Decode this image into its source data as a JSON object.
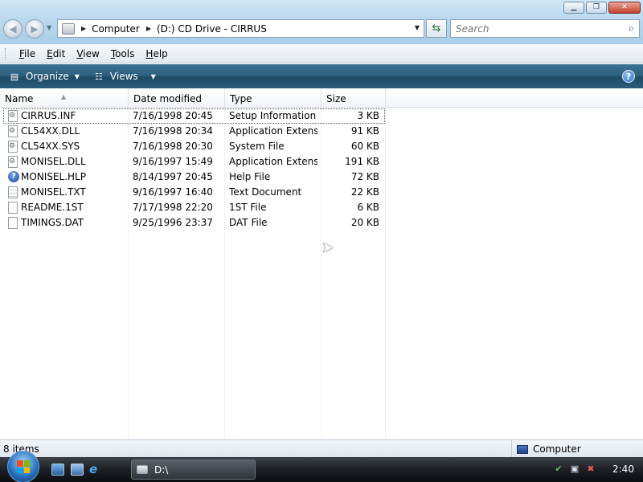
{
  "window": {
    "minimize_glyph": "▁",
    "maximize_glyph": "❐",
    "close_glyph": "✕"
  },
  "address": {
    "crumbs": [
      "Computer",
      "(D:) CD Drive - CIRRUS"
    ],
    "separator_glyph": "▶",
    "dropdown_glyph": "▼"
  },
  "search": {
    "placeholder": "Search"
  },
  "menu": {
    "file": {
      "key": "F",
      "rest": "ile"
    },
    "edit": {
      "key": "E",
      "rest": "dit"
    },
    "view": {
      "key": "V",
      "rest": "iew"
    },
    "tools": {
      "key": "T",
      "rest": "ools"
    },
    "help": {
      "key": "H",
      "rest": "elp"
    }
  },
  "commandbar": {
    "organize_label": "Organize",
    "views_label": "Views",
    "help_glyph": "?"
  },
  "columns": {
    "name": "Name",
    "date": "Date modified",
    "type": "Type",
    "size": "Size"
  },
  "files": [
    {
      "name": "CIRRUS.INF",
      "date": "7/16/1998 20:45",
      "type": "Setup Information",
      "size": "3 KB",
      "icon": "settings-file-icon"
    },
    {
      "name": "CL54XX.DLL",
      "date": "7/16/1998 20:34",
      "type": "Application Extens...",
      "size": "91 KB",
      "icon": "dll-file-icon"
    },
    {
      "name": "CL54XX.SYS",
      "date": "7/16/1998 20:30",
      "type": "System File",
      "size": "60 KB",
      "icon": "system-file-icon"
    },
    {
      "name": "MONISEL.DLL",
      "date": "9/16/1997 15:49",
      "type": "Application Extens...",
      "size": "191 KB",
      "icon": "dll-file-icon"
    },
    {
      "name": "MONISEL.HLP",
      "date": "8/14/1997 20:45",
      "type": "Help File",
      "size": "72 KB",
      "icon": "help-file-icon"
    },
    {
      "name": "MONISEL.TXT",
      "date": "9/16/1997 16:40",
      "type": "Text Document",
      "size": "22 KB",
      "icon": "text-file-icon"
    },
    {
      "name": "README.1ST",
      "date": "7/17/1998 22:20",
      "type": "1ST File",
      "size": "6 KB",
      "icon": "generic-file-icon"
    },
    {
      "name": "TIMINGS.DAT",
      "date": "9/25/1996 23:37",
      "type": "DAT File",
      "size": "20 KB",
      "icon": "generic-file-icon"
    }
  ],
  "status": {
    "item_count": "8 items",
    "location": "Computer"
  },
  "taskbar": {
    "task_label": "D:\\",
    "clock": "2:40"
  }
}
